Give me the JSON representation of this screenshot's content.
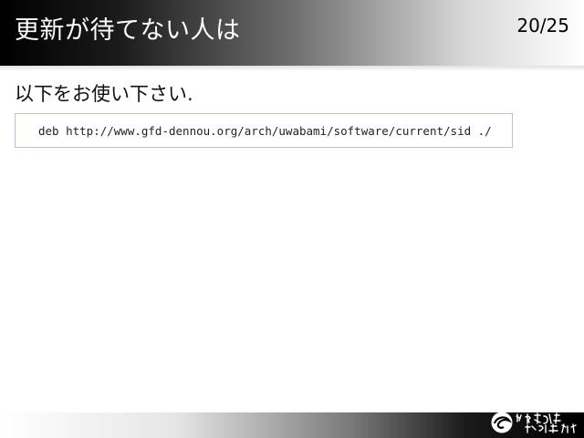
{
  "slide": {
    "title": "更新が待てない人は",
    "page_number": "20/25",
    "body_text": "以下をお使い下さい.",
    "code_line": "deb http://www.gfd-dennou.org/arch/uwabami/software/current/sid ./"
  },
  "colors": {
    "title_text": "#ffffff",
    "code_border": "#c9b9e6"
  },
  "footer": {
    "logo_icon": "gfd-dennou-logo-icon"
  }
}
